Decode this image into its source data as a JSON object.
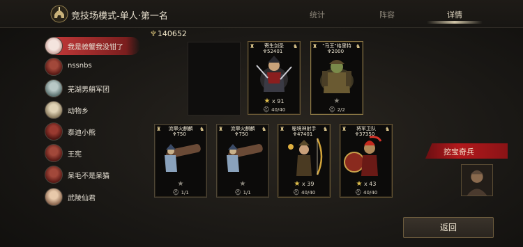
{
  "header": {
    "title": "竞技场模式-单人·第一名",
    "tabs": [
      "统计",
      "阵容",
      "详情"
    ],
    "active_tab": "详情"
  },
  "players": [
    {
      "name": "我是螃蟹我没钳了",
      "active": true,
      "avatar_color": "#e8d4cf"
    },
    {
      "name": "nssnbs",
      "active": false,
      "avatar_color": "#6e2a22"
    },
    {
      "name": "芜湖男艄军团",
      "active": false,
      "avatar_color": "#8aa0a2"
    },
    {
      "name": "动物乡",
      "active": false,
      "avatar_color": "#b9ab8c"
    },
    {
      "name": "泰迪小熊",
      "active": false,
      "avatar_color": "#6a2420"
    },
    {
      "name": "王宪",
      "active": false,
      "avatar_color": "#6e2a22"
    },
    {
      "name": "呆毛不是呆猫",
      "active": false,
      "avatar_color": "#6e2a22"
    },
    {
      "name": "武陵仙君",
      "active": false,
      "avatar_color": "#c6a384"
    }
  ],
  "power": "140652",
  "cards": [
    {
      "name": "寄生剑圣",
      "power": "52401",
      "stars": "x 91",
      "star_gold": true,
      "count": "40/40",
      "art": "samurai"
    },
    {
      "name": "\"马王\"格里特",
      "power": "2000",
      "stars": "",
      "star_gold": false,
      "count": "2/2",
      "art": "orc"
    },
    {
      "name": "流窜火麒麟",
      "power": "750",
      "stars": "",
      "star_gold": false,
      "count": "1/1",
      "art": "cannon"
    },
    {
      "name": "流窜火麒麟",
      "power": "750",
      "stars": "",
      "star_gold": false,
      "count": "1/1",
      "art": "cannon"
    },
    {
      "name": "秘境神射手",
      "power": "47401",
      "stars": "x 39",
      "star_gold": true,
      "count": "40/40",
      "art": "archer"
    },
    {
      "name": "将军卫队",
      "power": "37350",
      "stars": "x 43",
      "star_gold": true,
      "count": "40/40",
      "art": "spartan"
    }
  ],
  "treasure": {
    "label": "挖宝奇兵"
  },
  "back_button": "返回",
  "colors": {
    "accent_red": "#b3191c",
    "gold": "#d9c27a",
    "card_border": "#6c5a36"
  }
}
